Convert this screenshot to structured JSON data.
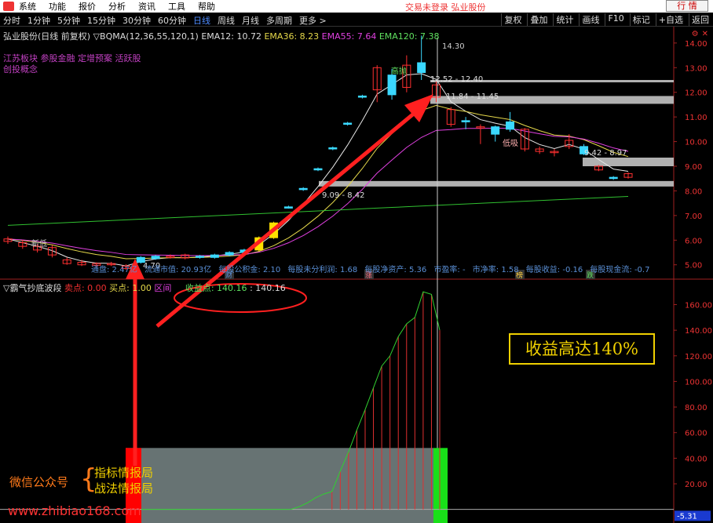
{
  "menu": {
    "items": [
      "系统",
      "功能",
      "报价",
      "分析",
      "资讯",
      "工具",
      "帮助"
    ],
    "status": "交易未登录 弘业股份",
    "trade_button": "行 情"
  },
  "periods": {
    "items": [
      "分时",
      "1分钟",
      "5分钟",
      "15分钟",
      "30分钟",
      "60分钟",
      "日线",
      "周线",
      "月线",
      "多周期",
      "更多 >"
    ],
    "active_index": 6
  },
  "right_tools": [
    "复权",
    "叠加",
    "统计",
    "画线",
    "F10",
    "标记",
    "+自选",
    "返回"
  ],
  "indicator_line": {
    "stock": "弘业股份(日线 前复权)",
    "formula": "▽BQMA(12,36,55,120,1)",
    "ema12": "EMA12: 10.72",
    "ema36": "EMA36: 8.23",
    "ema55": "EMA55: 7.64",
    "ema120": "EMA120: 7.38"
  },
  "tags": [
    "江苏板块 参股金融 定增预案 活跃股",
    "创投概念"
  ],
  "chart_data": {
    "type": "candlestick",
    "price_axis": {
      "ticks": [
        "14.00",
        "13.00",
        "12.00",
        "11.00",
        "10.00",
        "9.00",
        "8.00",
        "7.00",
        "6.00",
        "5.00"
      ],
      "range": [
        4.8,
        14.6
      ]
    },
    "candles": [
      {
        "o": 5.95,
        "c": 6.05,
        "h": 6.15,
        "l": 5.85,
        "up": false
      },
      {
        "o": 5.9,
        "c": 5.75,
        "h": 6.0,
        "l": 5.65,
        "up": false
      },
      {
        "o": 5.75,
        "c": 5.6,
        "h": 5.85,
        "l": 5.5,
        "up": false
      },
      {
        "o": 5.7,
        "c": 5.4,
        "h": 5.8,
        "l": 5.3,
        "up": false
      },
      {
        "o": 5.2,
        "c": 5.05,
        "h": 5.3,
        "l": 5.0,
        "up": false
      },
      {
        "o": 5.1,
        "c": 5.0,
        "h": 5.2,
        "l": 4.95,
        "up": false
      },
      {
        "o": 5.05,
        "c": 4.98,
        "h": 5.1,
        "l": 4.9,
        "up": false
      },
      {
        "o": 5.0,
        "c": 5.05,
        "h": 5.12,
        "l": 4.95,
        "up": false
      },
      {
        "o": 4.95,
        "c": 4.85,
        "h": 5.02,
        "l": 4.8,
        "up": false
      },
      {
        "o": 5.1,
        "c": 5.3,
        "h": 5.35,
        "l": 5.05,
        "up": true
      },
      {
        "o": 5.25,
        "c": 5.35,
        "h": 5.4,
        "l": 5.2,
        "up": true
      },
      {
        "o": 5.3,
        "c": 5.35,
        "h": 5.42,
        "l": 5.25,
        "up": false
      },
      {
        "o": 5.4,
        "c": 5.28,
        "h": 5.45,
        "l": 5.22,
        "up": false
      },
      {
        "o": 5.3,
        "c": 5.35,
        "h": 5.4,
        "l": 5.25,
        "up": true
      },
      {
        "o": 5.3,
        "c": 5.4,
        "h": 5.45,
        "l": 5.25,
        "up": true
      },
      {
        "o": 5.4,
        "c": 5.5,
        "h": 5.55,
        "l": 5.35,
        "up": true
      },
      {
        "o": 5.5,
        "c": 5.6,
        "h": 5.65,
        "l": 5.45,
        "up": true
      },
      {
        "o": 5.6,
        "c": 6.1,
        "h": 6.15,
        "l": 5.55,
        "up": true,
        "yellow": true
      },
      {
        "o": 6.1,
        "c": 6.7,
        "h": 6.75,
        "l": 6.05,
        "up": true,
        "yellow": true
      },
      {
        "o": 7.3,
        "c": 7.35,
        "h": 7.4,
        "l": 7.28,
        "up": true
      },
      {
        "o": 8.05,
        "c": 8.1,
        "h": 8.15,
        "l": 8.0,
        "up": true
      },
      {
        "o": 8.85,
        "c": 8.9,
        "h": 8.95,
        "l": 8.8,
        "up": true
      },
      {
        "o": 9.7,
        "c": 9.75,
        "h": 9.8,
        "l": 9.65,
        "up": true
      },
      {
        "o": 10.7,
        "c": 10.75,
        "h": 10.8,
        "l": 10.65,
        "up": true
      },
      {
        "o": 11.8,
        "c": 11.85,
        "h": 11.9,
        "l": 11.75,
        "up": true
      },
      {
        "o": 12.1,
        "c": 13.0,
        "h": 13.1,
        "l": 11.6,
        "up": false
      },
      {
        "o": 11.9,
        "c": 12.7,
        "h": 12.95,
        "l": 11.7,
        "up": true
      },
      {
        "o": 12.2,
        "c": 13.1,
        "h": 13.5,
        "l": 12.0,
        "up": false
      },
      {
        "o": 13.2,
        "c": 12.8,
        "h": 14.3,
        "l": 12.5,
        "up": true
      },
      {
        "o": 11.8,
        "c": 12.3,
        "h": 12.45,
        "l": 11.6,
        "up": false
      },
      {
        "o": 11.3,
        "c": 10.7,
        "h": 11.4,
        "l": 10.6,
        "up": false
      },
      {
        "o": 10.8,
        "c": 10.85,
        "h": 11.0,
        "l": 10.5,
        "up": true
      },
      {
        "o": 10.6,
        "c": 10.55,
        "h": 10.7,
        "l": 9.9,
        "up": false
      },
      {
        "o": 10.3,
        "c": 10.6,
        "h": 10.65,
        "l": 10.0,
        "up": true
      },
      {
        "o": 10.8,
        "c": 10.5,
        "h": 11.2,
        "l": 10.4,
        "up": true
      },
      {
        "o": 10.5,
        "c": 9.7,
        "h": 10.55,
        "l": 9.6,
        "up": false
      },
      {
        "o": 9.7,
        "c": 9.6,
        "h": 9.8,
        "l": 9.5,
        "up": false
      },
      {
        "o": 9.6,
        "c": 9.55,
        "h": 9.7,
        "l": 9.4,
        "up": false
      },
      {
        "o": 9.8,
        "c": 10.05,
        "h": 10.3,
        "l": 9.7,
        "up": false
      },
      {
        "o": 9.8,
        "c": 9.5,
        "h": 9.9,
        "l": 9.45,
        "up": true
      },
      {
        "o": 9.0,
        "c": 8.85,
        "h": 9.05,
        "l": 8.8,
        "up": false
      },
      {
        "o": 8.55,
        "c": 8.5,
        "h": 8.6,
        "l": 8.45,
        "up": true
      },
      {
        "o": 8.55,
        "c": 8.7,
        "h": 8.75,
        "l": 8.5,
        "up": false
      }
    ],
    "annotations": [
      "14.30",
      "12.52 - 12.40",
      "11.84 - 11.45",
      "9.42 - 8.97",
      "9.09 - 8.42",
      "4.70",
      "高抛",
      "低吸",
      "新低"
    ],
    "sub_axis": {
      "ticks": [
        "160.00",
        "140.00",
        "120.00",
        "100.00",
        "80.00",
        "60.00",
        "40.00",
        "20.00"
      ],
      "range": [
        -10,
        175
      ],
      "last_value": "-5.31"
    },
    "profit_curve": [
      0,
      0,
      0,
      0,
      0,
      0,
      0,
      0,
      0,
      0,
      0,
      0,
      0,
      0,
      0,
      0,
      0,
      0,
      0,
      2,
      5,
      9,
      12,
      14,
      30,
      45,
      62,
      78,
      95,
      112,
      120,
      135,
      145,
      150,
      170,
      168,
      140
    ]
  },
  "fund_row": [
    "通盘: 2.47亿",
    "流通市值: 20.93亿",
    "每股公积金: 2.10",
    "每股未分利润: 1.68",
    "每股净资产: 5.36",
    "市盈率: -",
    "市净率: 1.58",
    "每股收益: -0.16",
    "每股现金流: -0.7"
  ],
  "markers": [
    "财",
    "涨",
    "榜",
    "跌"
  ],
  "sub_indicator": {
    "name": "▽霸气抄底波段",
    "sell": "卖点: 0.00",
    "buy": "买点: 1.00",
    "range": "区间",
    "profit": "收益点: 140.16",
    "profit2": ": 140.16"
  },
  "promo": {
    "box": "收益高达140%",
    "wx_label": "微信公众号",
    "brace": "{",
    "accounts": [
      "指标情报局",
      "战法情报局"
    ],
    "site": "www.zhibiao168.com"
  },
  "colors": {
    "up": "#3ad8ff",
    "down": "#ff3030",
    "ema12": "#e8e8e8",
    "ema36": "#e5d84a",
    "ema55": "#e040e0",
    "ema120": "#30c030"
  }
}
